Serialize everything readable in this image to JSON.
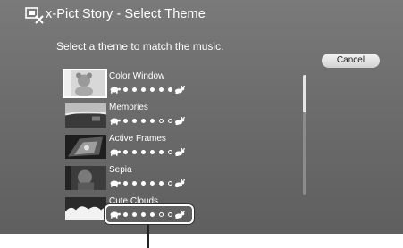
{
  "window": {
    "title": "x-Pict Story - Select Theme",
    "subtitle": "Select a theme to match the music.",
    "title_icon": "x-pict-story-icon"
  },
  "actions": {
    "cancel_label": "Cancel"
  },
  "themes": [
    {
      "name": "Color Window",
      "speed_filled": 6,
      "speed_total": 6,
      "selected": true,
      "thumb": "teddy-bear-photo"
    },
    {
      "name": "Memories",
      "speed_filled": 4,
      "speed_total": 6,
      "selected": false,
      "thumb": "horizon-photo"
    },
    {
      "name": "Active Frames",
      "speed_filled": 5,
      "speed_total": 6,
      "selected": false,
      "thumb": "frames-photo"
    },
    {
      "name": "Sepia",
      "speed_filled": 5,
      "speed_total": 6,
      "selected": false,
      "thumb": "sepia-photo"
    },
    {
      "name": "Cute Clouds",
      "speed_filled": 4,
      "speed_total": 6,
      "selected": false,
      "thumb": "clouds-photo"
    }
  ],
  "speed_indicator": {
    "slow_icon": "turtle-icon",
    "fast_icon": "rabbit-icon"
  },
  "scrollbar": {
    "position": 0.0,
    "visible_fraction": 0.31
  },
  "colors": {
    "background": "#6f6f6f",
    "text": "#ffffff",
    "button": "#e0e0e0"
  }
}
